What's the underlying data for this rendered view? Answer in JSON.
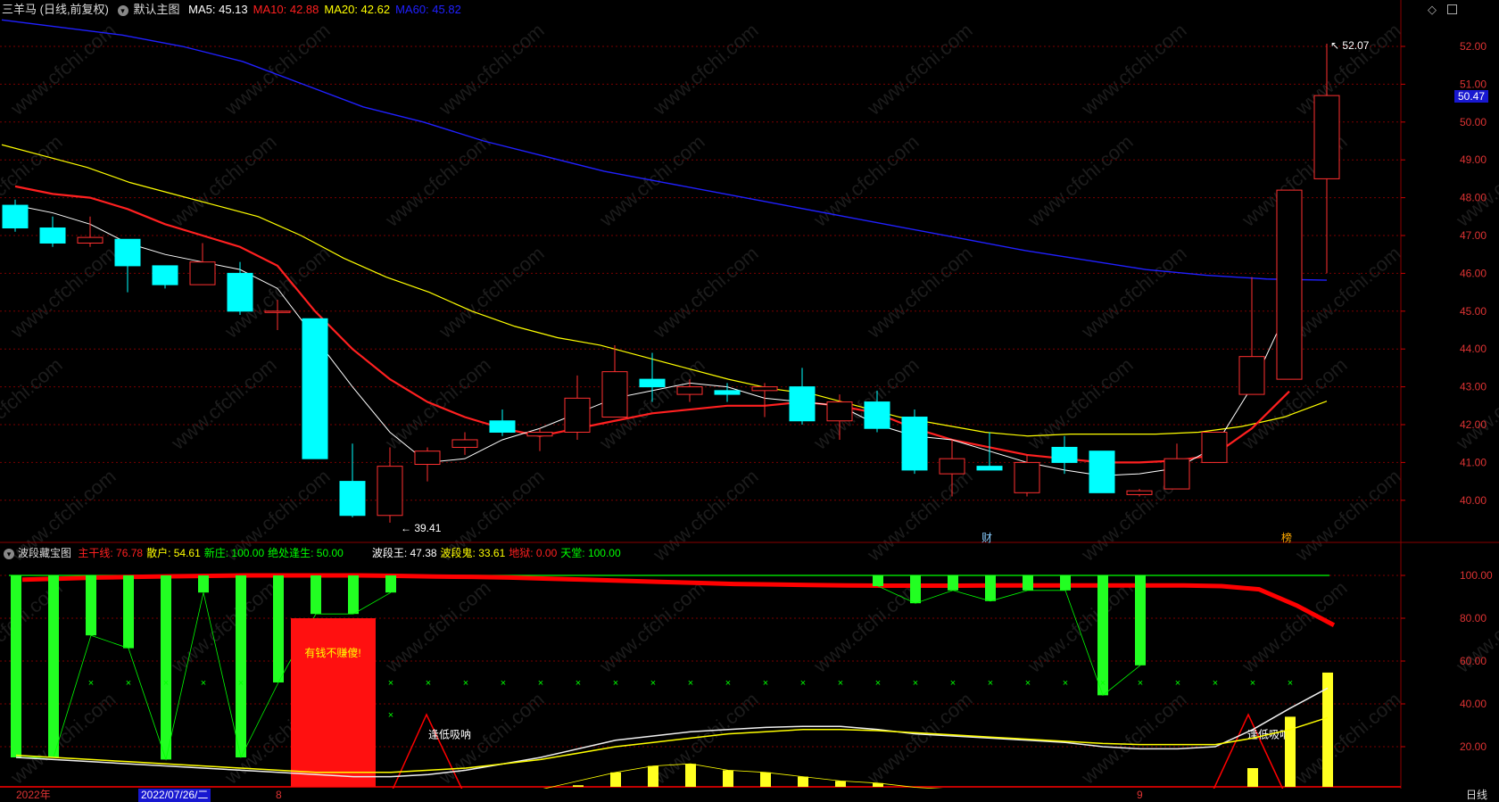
{
  "main_header": {
    "stock_label": "三羊马 (日线,前复权)",
    "template_label": "默认主图",
    "indicators": [
      {
        "text": "MA5: 45.13",
        "color": "#ffffff"
      },
      {
        "text": "MA10: 42.88",
        "color": "#ff2020"
      },
      {
        "text": "MA20: 42.62",
        "color": "#ffff00"
      },
      {
        "text": "MA60: 45.82",
        "color": "#2020ff"
      }
    ]
  },
  "sub_header": {
    "title": "波段藏宝图",
    "indicators": [
      {
        "text": "主干线: 76.78",
        "color": "#ff2020"
      },
      {
        "text": "散户: 54.61",
        "color": "#ffff00"
      },
      {
        "text": "新庄: 100.00",
        "color": "#00ff00"
      },
      {
        "text": "绝处逢生: 50.00",
        "color": "#00ff00"
      },
      {
        "text": "波段王: 47.38",
        "color": "#ffffff"
      },
      {
        "text": "波段鬼: 33.61",
        "color": "#ffff00"
      },
      {
        "text": "地狱: 0.00",
        "color": "#ff2020"
      },
      {
        "text": "天堂: 100.00",
        "color": "#00ff00"
      }
    ]
  },
  "price_axis": [
    "52.00",
    "51.00",
    "50.00",
    "49.00",
    "48.00",
    "47.00",
    "46.00",
    "45.00",
    "44.00",
    "43.00",
    "42.00",
    "41.00",
    "40.00"
  ],
  "current_price_tag": "50.47",
  "high_label": "52.07",
  "low_label": "39.41",
  "markers": {
    "cai": "财",
    "bang": "榜"
  },
  "sub_axis": [
    "100.00",
    "80.00",
    "60.00",
    "40.00",
    "20.00"
  ],
  "annotations": {
    "red_block": "有钱不赚傻!",
    "low_buy_1": "逢低吸呐",
    "low_buy_2": "逢低吸呐"
  },
  "bottom_bar": {
    "year": "2022年",
    "date": "2022/07/26/二",
    "m8": "8",
    "m9": "9",
    "period": "日线"
  },
  "colors": {
    "up": "#ff3030",
    "down": "#00ffff",
    "ma5": "#ffffff",
    "ma10": "#ff2020",
    "ma20": "#ffff00",
    "ma60": "#2020ff",
    "grid": "#7a0000"
  },
  "candles": [
    {
      "o": 47.8,
      "h": 47.95,
      "l": 47.1,
      "c": 47.2
    },
    {
      "o": 47.2,
      "h": 47.5,
      "l": 46.7,
      "c": 46.8
    },
    {
      "o": 46.8,
      "h": 47.5,
      "l": 46.7,
      "c": 46.95
    },
    {
      "o": 46.9,
      "h": 46.9,
      "l": 45.5,
      "c": 46.2
    },
    {
      "o": 46.2,
      "h": 46.2,
      "l": 45.6,
      "c": 45.7
    },
    {
      "o": 45.7,
      "h": 46.8,
      "l": 45.7,
      "c": 46.3
    },
    {
      "o": 46.0,
      "h": 46.3,
      "l": 44.9,
      "c": 45.0
    },
    {
      "o": 45.0,
      "h": 45.3,
      "l": 44.5,
      "c": 45.0
    },
    {
      "o": 44.8,
      "h": 44.8,
      "l": 41.1,
      "c": 41.1
    },
    {
      "o": 40.5,
      "h": 41.5,
      "l": 39.55,
      "c": 39.6
    },
    {
      "o": 39.6,
      "h": 41.4,
      "l": 39.41,
      "c": 40.9
    },
    {
      "o": 40.95,
      "h": 41.4,
      "l": 40.5,
      "c": 41.3
    },
    {
      "o": 41.4,
      "h": 41.8,
      "l": 41.2,
      "c": 41.6
    },
    {
      "o": 42.1,
      "h": 42.4,
      "l": 41.7,
      "c": 41.8
    },
    {
      "o": 41.7,
      "h": 41.9,
      "l": 41.3,
      "c": 41.8
    },
    {
      "o": 41.8,
      "h": 43.3,
      "l": 41.6,
      "c": 42.7
    },
    {
      "o": 42.2,
      "h": 44.1,
      "l": 42.2,
      "c": 43.4
    },
    {
      "o": 43.2,
      "h": 43.9,
      "l": 42.6,
      "c": 43.0
    },
    {
      "o": 42.8,
      "h": 43.2,
      "l": 42.6,
      "c": 43.0
    },
    {
      "o": 42.9,
      "h": 43.1,
      "l": 42.6,
      "c": 42.8
    },
    {
      "o": 42.9,
      "h": 43.1,
      "l": 42.2,
      "c": 43.0
    },
    {
      "o": 43.0,
      "h": 43.5,
      "l": 42.0,
      "c": 42.1
    },
    {
      "o": 42.1,
      "h": 42.8,
      "l": 41.6,
      "c": 42.6
    },
    {
      "o": 42.6,
      "h": 42.9,
      "l": 41.8,
      "c": 41.9
    },
    {
      "o": 42.2,
      "h": 42.4,
      "l": 40.7,
      "c": 40.8
    },
    {
      "o": 40.7,
      "h": 41.6,
      "l": 40.1,
      "c": 41.1
    },
    {
      "o": 40.9,
      "h": 41.8,
      "l": 40.8,
      "c": 40.8
    },
    {
      "o": 40.2,
      "h": 41.2,
      "l": 40.1,
      "c": 41.0
    },
    {
      "o": 41.4,
      "h": 41.7,
      "l": 40.7,
      "c": 41.0
    },
    {
      "o": 41.3,
      "h": 41.3,
      "l": 40.2,
      "c": 40.2
    },
    {
      "o": 40.15,
      "h": 40.3,
      "l": 40.1,
      "c": 40.25
    },
    {
      "o": 40.3,
      "h": 41.5,
      "l": 40.3,
      "c": 41.1
    },
    {
      "o": 41.0,
      "h": 41.8,
      "l": 41.0,
      "c": 41.8
    },
    {
      "o": 42.8,
      "h": 45.9,
      "l": 42.8,
      "c": 43.8
    },
    {
      "o": 43.2,
      "h": 48.2,
      "l": 43.2,
      "c": 48.2
    },
    {
      "o": 48.5,
      "h": 52.07,
      "l": 46.0,
      "c": 50.7
    }
  ],
  "ma5": [
    47.8,
    47.6,
    47.3,
    46.8,
    46.5,
    46.3,
    46.1,
    45.6,
    44.3,
    43.0,
    41.8,
    41.0,
    41.1,
    41.6,
    41.9,
    42.3,
    42.7,
    42.9,
    43.1,
    43.0,
    42.7,
    42.6,
    42.5,
    42.0,
    41.7,
    41.6,
    41.3,
    41.0,
    40.8,
    40.65,
    40.7,
    40.85,
    41.4,
    43.0,
    45.13
  ],
  "ma10": [
    48.3,
    48.1,
    48.0,
    47.7,
    47.3,
    47.0,
    46.7,
    46.2,
    45.0,
    44.0,
    43.2,
    42.6,
    42.2,
    41.9,
    41.7,
    41.9,
    42.1,
    42.3,
    42.4,
    42.5,
    42.5,
    42.6,
    42.5,
    42.3,
    41.9,
    41.6,
    41.4,
    41.2,
    41.1,
    41.0,
    41.0,
    41.05,
    41.2,
    41.9,
    42.88
  ],
  "ma20": [
    49.4,
    49.1,
    48.8,
    48.4,
    48.1,
    47.8,
    47.5,
    47.0,
    46.4,
    45.9,
    45.5,
    45.0,
    44.6,
    44.3,
    44.1,
    43.8,
    43.5,
    43.2,
    42.95,
    42.8,
    42.5,
    42.2,
    42.0,
    41.8,
    41.7,
    41.75,
    41.75,
    41.75,
    41.8,
    41.95,
    42.2,
    42.62
  ],
  "ma60": [
    52.7,
    52.5,
    52.3,
    52.0,
    51.6,
    51.0,
    50.4,
    50.0,
    49.5,
    49.1,
    48.7,
    48.4,
    48.1,
    47.8,
    47.5,
    47.2,
    46.9,
    46.6,
    46.35,
    46.1,
    45.95,
    45.85,
    45.82
  ]
}
